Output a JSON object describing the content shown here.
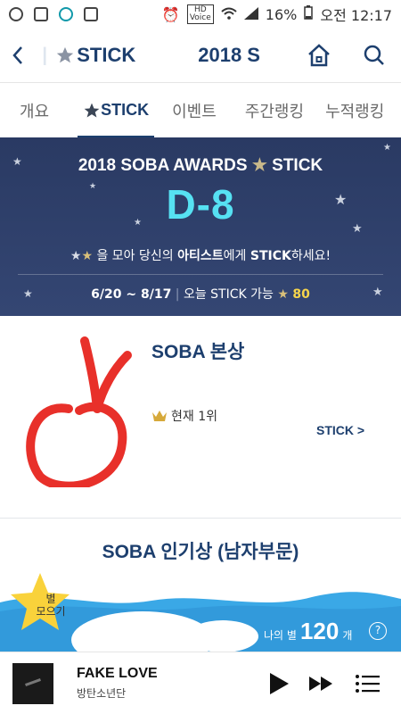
{
  "statusbar": {
    "battery": "16%",
    "time_label": "오전 12:17",
    "hd_top": "HD",
    "hd_bottom": "Voice"
  },
  "header": {
    "title_left": "STICK",
    "title_mid": "2018 S"
  },
  "tabs": [
    {
      "label": "개요"
    },
    {
      "label": "STICK"
    },
    {
      "label": "이벤트"
    },
    {
      "label": "주간랭킹"
    },
    {
      "label": "누적랭킹"
    }
  ],
  "banner": {
    "title_pre": "2018 SOBA AWARDS",
    "title_post": "STICK",
    "dday": "D-8",
    "msg_part1": "을 모아 당신의 ",
    "msg_artist": "아티스트",
    "msg_part2": "에게 ",
    "msg_stick": "STICK",
    "msg_part3": "하세요!",
    "period": "6/20 ~ 8/17",
    "today_label": "오늘 STICK 가능",
    "today_count": "80"
  },
  "award1": {
    "title": "SOBA 본상",
    "rank": "현재 1위",
    "stick_link": "STICK >"
  },
  "award2": {
    "title": "SOBA 인기상 (남자부문)"
  },
  "star_badge": {
    "line1": "별",
    "line2": "모으기"
  },
  "my_stars": {
    "label": "나의 별",
    "count": "120",
    "unit": "개",
    "help": "?"
  },
  "player": {
    "song": "FAKE LOVE",
    "artist": "방탄소년단"
  },
  "colors": {
    "brand_navy": "#1d3f6e",
    "banner_bg": "#2a3a63",
    "dday_cyan": "#56e1f2",
    "accent_yellow": "#f7d54b",
    "wave_blue": "#3aa8e6"
  }
}
